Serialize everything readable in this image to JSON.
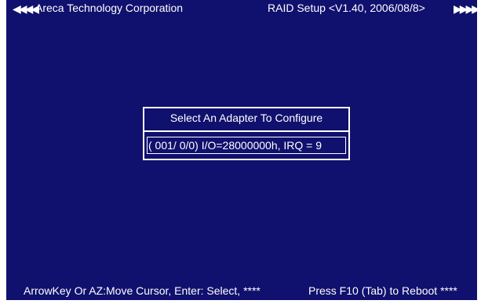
{
  "header": {
    "left_arrows": "◀◀◀◀",
    "left_title": "Areca Technology Corporation",
    "right_title": "RAID Setup <V1.40, 2006/08/8>",
    "right_arrows": "▶▶▶▶"
  },
  "dialog": {
    "title": "Select An Adapter To Configure",
    "items": [
      "( 001/ 0/0) I/O=28000000h, IRQ = 9"
    ]
  },
  "statusbar": {
    "left_text": "ArrowKey Or AZ:Move Cursor, Enter: Select, ****",
    "right_text": "Press F10 (Tab) to Reboot  ****"
  },
  "colors": {
    "screen_background": "#10106e",
    "foreground": "#ffffff"
  }
}
